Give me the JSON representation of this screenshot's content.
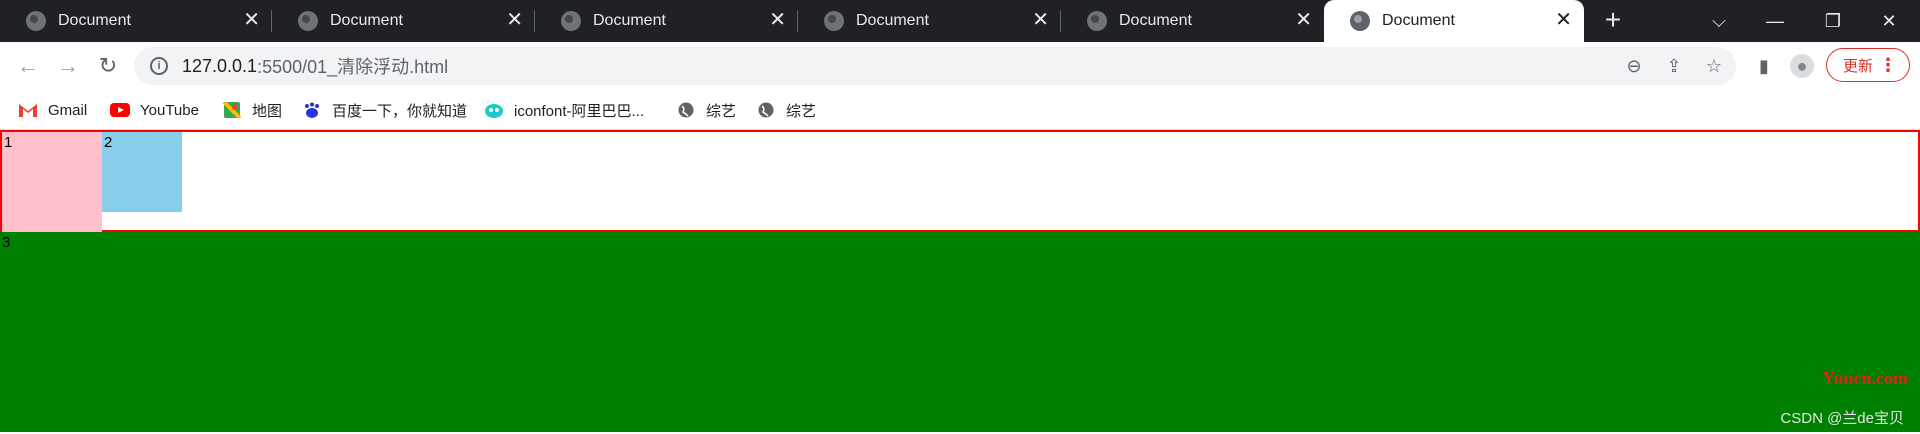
{
  "tabs": [
    {
      "title": "Document",
      "active": false
    },
    {
      "title": "Document",
      "active": false
    },
    {
      "title": "Document",
      "active": false
    },
    {
      "title": "Document",
      "active": false
    },
    {
      "title": "Document",
      "active": false
    },
    {
      "title": "Document",
      "active": true
    }
  ],
  "tab_close_glyph": "✕",
  "new_tab_glyph": "+",
  "window_controls": {
    "menu": "⌵",
    "minimize": "—",
    "restore": "❐",
    "close": "✕"
  },
  "toolbar": {
    "back": "←",
    "forward": "→",
    "reload": "↻",
    "url_host": "127.0.0.1",
    "url_path": ":5500/01_清除浮动.html",
    "zoom_icon": "⊖",
    "share_icon": "⇪",
    "star_icon": "☆",
    "sidepanel_icon": "▮",
    "profile_icon": "●",
    "update_label": "更新",
    "menu_icon": "⋮"
  },
  "bookmarks": [
    {
      "label": "Gmail",
      "icon": "gmail-icon",
      "color": "#ea4335"
    },
    {
      "label": "YouTube",
      "icon": "youtube-icon",
      "color": "#ff0000"
    },
    {
      "label": "地图",
      "icon": "maps-icon",
      "color": "#34a853"
    },
    {
      "label": "百度一下，你就知道",
      "icon": "baidu-icon",
      "color": "#2932e1"
    },
    {
      "label": "iconfont-阿里巴巴...",
      "icon": "iconfont-icon",
      "color": "#1ecbc4"
    },
    {
      "label": "综艺",
      "icon": "globe-icon",
      "color": "#5f6368"
    },
    {
      "label": "综艺",
      "icon": "globe-icon",
      "color": "#5f6368"
    }
  ],
  "page": {
    "box1_text": "1",
    "box2_text": "2",
    "box3_text": "3",
    "watermark_site": "Yuucn.com",
    "watermark_author": "CSDN @兰de宝贝"
  },
  "colors": {
    "father_border": "#ff0000",
    "box1": "#ffc0cb",
    "box2": "#87ceeb",
    "box3": "#008000"
  }
}
